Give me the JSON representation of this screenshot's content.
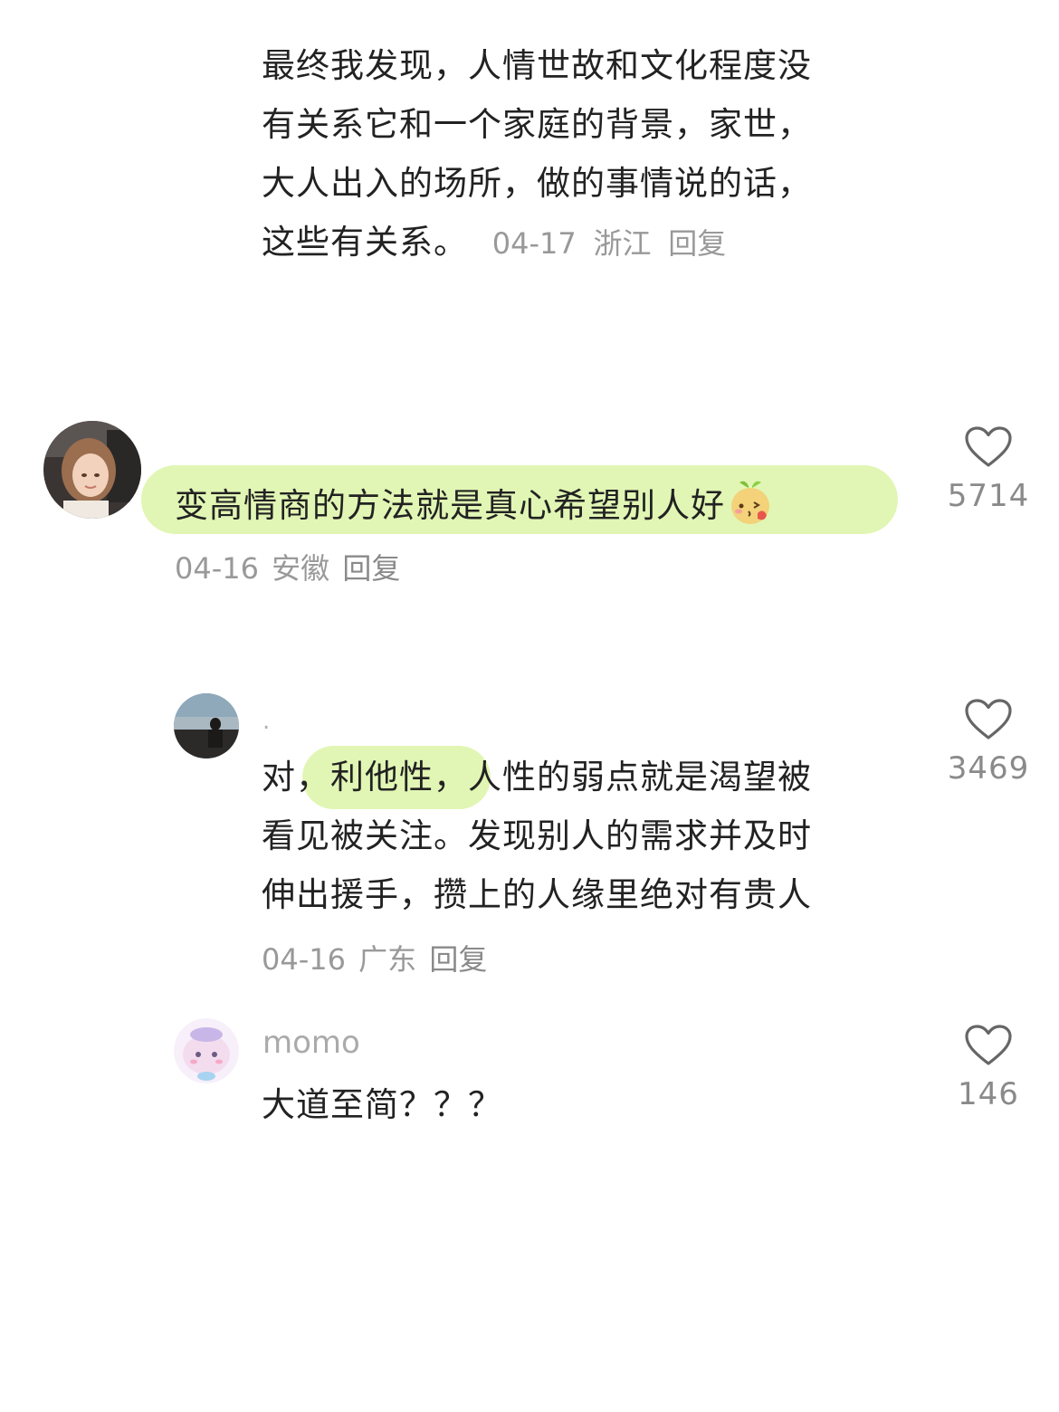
{
  "comments": [
    {
      "text_lines": [
        "最终我发现，人情世故和文化程度没",
        "有关系它和一个家庭的背景，家世，",
        "大人出入的场所，做的事情说的话，",
        "这些有关系。"
      ],
      "date": "04-17",
      "location": "浙江",
      "reply_label": "回复"
    },
    {
      "text": "变高情商的方法就是真心希望别人好",
      "emoji_icon": "blushing-sprout-emoji-icon",
      "date": "04-16",
      "location": "安徽",
      "reply_label": "回复",
      "likes": "5714",
      "highlight_color": "#e1f6b4"
    },
    {
      "username": ".",
      "text_prefix": "对",
      "text_highlight": "，利他性，",
      "text_lines_rest": [
        "人性的弱点就是渴望被",
        "看见被关注。发现别人的需求并及时",
        "伸出援手，攒上的人缘里绝对有贵人"
      ],
      "date": "04-16",
      "location": "广东",
      "reply_label": "回复",
      "likes": "3469"
    },
    {
      "username": "momo",
      "text": "大道至简？？？",
      "likes": "146"
    }
  ],
  "icons": {
    "like": "heart-outline-icon"
  }
}
